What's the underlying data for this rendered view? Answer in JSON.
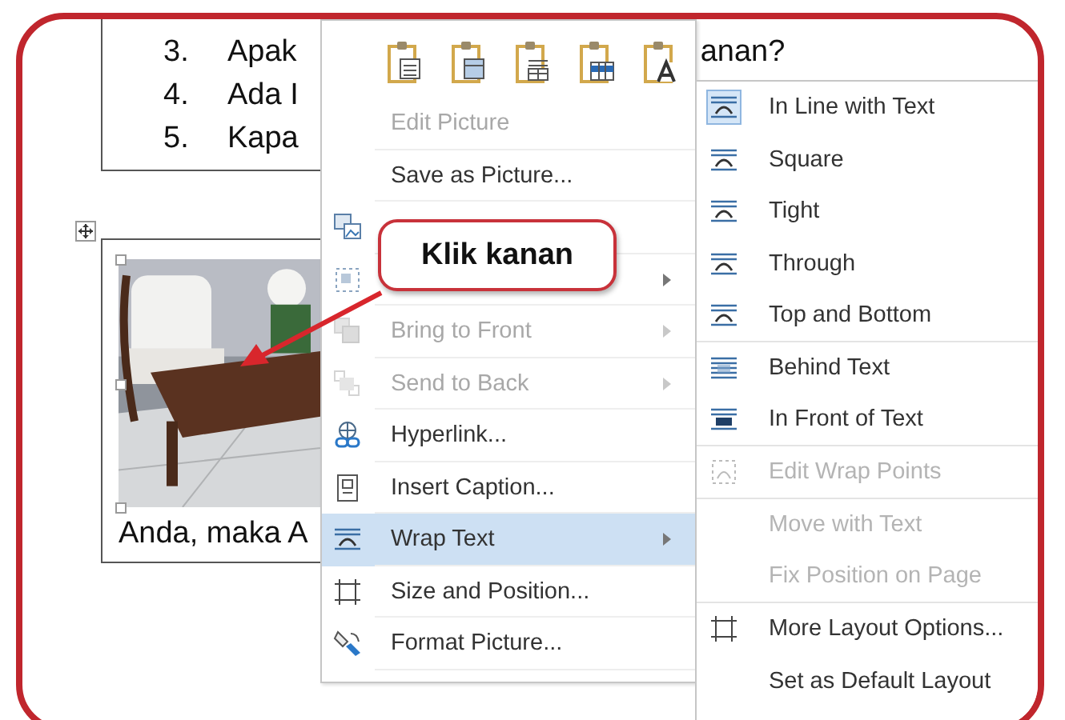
{
  "document": {
    "list_items": [
      {
        "number": "3.",
        "text": "Apak"
      },
      {
        "number": "4.",
        "text": "Ada I"
      },
      {
        "number": "5.",
        "text": "Kapa"
      }
    ],
    "trailing_text": "anan?",
    "caption": "Anda, maka A"
  },
  "context_menu": {
    "items": [
      {
        "label": "Edit Picture",
        "disabled": true,
        "submenu": false,
        "selected": false
      },
      {
        "label": "Save as Picture...",
        "disabled": false,
        "submenu": false,
        "selected": false
      },
      {
        "disabled": false,
        "submenu": false,
        "selected": false
      },
      {
        "disabled": false,
        "submenu": true,
        "selected": false
      },
      {
        "label": "Bring to Front",
        "disabled": true,
        "submenu": true,
        "selected": false
      },
      {
        "label": "Send to Back",
        "disabled": true,
        "submenu": true,
        "selected": false
      },
      {
        "label": "Hyperlink...",
        "disabled": false,
        "submenu": false,
        "selected": false
      },
      {
        "label": "Insert Caption...",
        "disabled": false,
        "submenu": false,
        "selected": false
      },
      {
        "label": "Wrap Text",
        "disabled": false,
        "submenu": true,
        "selected": true
      },
      {
        "label": "Size and Position...",
        "disabled": false,
        "submenu": false,
        "selected": false
      },
      {
        "label": "Format Picture...",
        "disabled": false,
        "submenu": false,
        "selected": false
      }
    ]
  },
  "wrap_submenu": {
    "items": [
      {
        "label": "In Line with Text",
        "disabled": false,
        "checked": true,
        "separator_after": false
      },
      {
        "label": "Square",
        "disabled": false,
        "checked": false,
        "separator_after": false
      },
      {
        "label": "Tight",
        "disabled": false,
        "checked": false,
        "separator_after": false
      },
      {
        "label": "Through",
        "disabled": false,
        "checked": false,
        "separator_after": false
      },
      {
        "label": "Top and Bottom",
        "disabled": false,
        "checked": false,
        "separator_after": true
      },
      {
        "label": "Behind Text",
        "disabled": false,
        "checked": false,
        "separator_after": false
      },
      {
        "label": "In Front of Text",
        "disabled": false,
        "checked": false,
        "separator_after": true
      },
      {
        "label": "Edit Wrap Points",
        "disabled": true,
        "checked": false,
        "separator_after": true
      },
      {
        "label": "Move with Text",
        "disabled": true,
        "checked": false,
        "separator_after": false
      },
      {
        "label": "Fix Position on Page",
        "disabled": true,
        "checked": false,
        "separator_after": true
      },
      {
        "label": "More Layout Options...",
        "disabled": false,
        "checked": false,
        "separator_after": false
      },
      {
        "label": "Set as Default Layout",
        "disabled": false,
        "checked": false,
        "separator_after": false
      }
    ]
  },
  "callout": {
    "text": "Klik kanan"
  }
}
